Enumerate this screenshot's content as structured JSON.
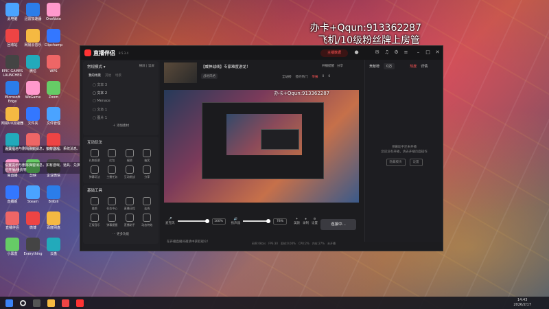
{
  "desktop": {
    "overlay_line1": "办卡+Qqun:913362287",
    "overlay_line2": "飞机/10级粉丝牌上房管",
    "icons_col1": [
      "此电脑",
      "回收站",
      "EPIC GAMES LAUNCHER",
      "Microsoft Edge",
      "网易UU加速器",
      "酷狗音乐",
      "易直播",
      "直播姬",
      "直播伴侣",
      "小黑盒"
    ],
    "icons_col2": [
      "迅雷加速器",
      "网易云音乐",
      "微信",
      "WeGame",
      "文件夹",
      "拼多多",
      "剪映",
      "Steam",
      "微博",
      "Everything"
    ],
    "icons_col3": [
      "OneNote",
      "Clipchamp",
      "WPS",
      "Zoom",
      "文件管理",
      "腾讯会议",
      "企业微信",
      "Bilibili",
      "百度网盘",
      "云盘"
    ],
    "notice1": "设置提示与删除弹窗消息，如有游戏、系统消息、粉丝牌升级等",
    "notice2": "设置提示与删除弹窗消息，如有游戏、道具、兑换开播/续费，私信开播/续费等"
  },
  "window": {
    "app_name": "直播伴侣",
    "version": "8.5.3.4",
    "live_button": "主播数据",
    "mode_label": "常规模式",
    "mode_options": [
      "横屏",
      "竖屏"
    ],
    "scenes_tab_active": "我的场景",
    "scenes_tab2": "其他",
    "scenes_tab3": "场景",
    "scenes": [
      "文本 3",
      "文本 2",
      "Menace",
      "文本 1",
      "图片 1"
    ],
    "add_material": "添加素材",
    "interact_title": "互动玩法",
    "interact_items": [
      "礼物投票",
      "红包",
      "福袋",
      "抽奖",
      "弹幕玩法",
      "主播任务",
      "互动挑战",
      "分享"
    ],
    "basic_title": "基础工具",
    "basic_items": [
      "美颜",
      "任务中心",
      "直播日程",
      "连线",
      "正版音乐",
      "弹幕提醒",
      "直播助手",
      "动态特效"
    ],
    "more_features": "更多功能",
    "stream_title": "【威神战线】专家难度游龙！",
    "stream_category": "战地风格",
    "top_actions": [
      "开播提醒",
      "分享",
      "全站榜",
      "签约热门",
      "举报"
    ],
    "counts": [
      "0",
      "0"
    ],
    "controls": {
      "mic_label": "麦克风",
      "mic_pct": "100%",
      "speaker_label": "扬声器",
      "speaker_pct": "78%",
      "beauty_label": "美颜",
      "record_label": "录制",
      "settings_label": "设置",
      "start_button": "连接中..."
    },
    "footer_hint": "在开播直播间邀请中获取观众！",
    "status": [
      "码率:0kb/s",
      "FPS:30",
      "丢帧:0.00%",
      "CPU:2%",
      "内存:27%",
      "未开播"
    ],
    "right_panel": {
      "tab1": "贡献榜",
      "tab2": "0万",
      "tab3": "热度",
      "tab4": "详情",
      "empty_text1": "弹幕助手还未开播",
      "empty_text2": "您还没有开播，请去开播页面操作",
      "btn1": "隐藏模块",
      "btn2": "设置"
    }
  },
  "taskbar": {
    "time": "14:43",
    "date": "2026/2/17"
  }
}
